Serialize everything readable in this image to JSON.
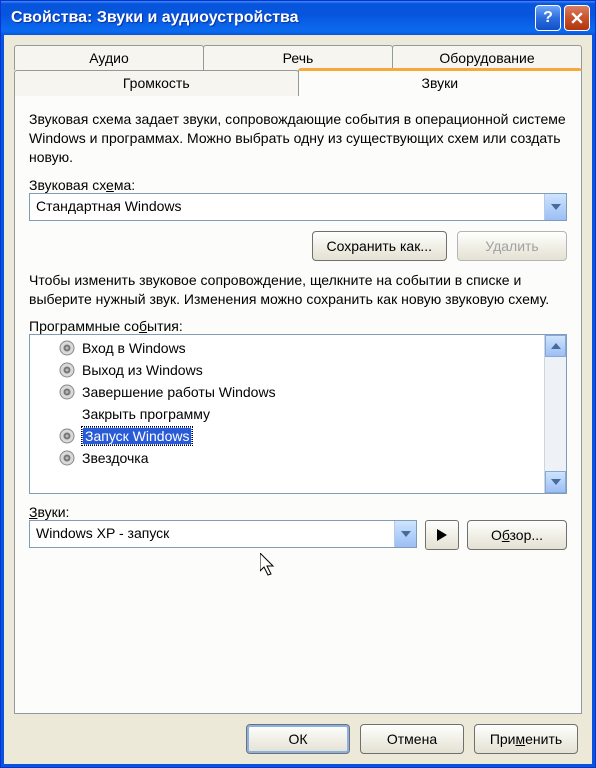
{
  "title": "Свойства: Звуки и аудиоустройства",
  "tabs_row1": [
    {
      "label": "Аудио"
    },
    {
      "label": "Речь"
    },
    {
      "label": "Оборудование"
    }
  ],
  "tabs_row2": [
    {
      "label": "Громкость"
    },
    {
      "label": "Звуки",
      "active": true
    }
  ],
  "scheme_desc": "Звуковая схема задает звуки, сопровождающие события в операционной системе Windows и программах. Можно выбрать одну из существующих схем или создать новую.",
  "scheme_label_pre": "Звуковая сх",
  "scheme_label_ul": "е",
  "scheme_label_post": "ма:",
  "scheme_value": "Стандартная Windows",
  "save_as_label": "Сохранить как...",
  "delete_label": "Удалить",
  "events_desc": "Чтобы изменить звуковое сопровождение, щелкните на событии в списке и выберите нужный звук. Изменения можно сохранить как новую звуковую схему.",
  "events_label_pre": "Программные со",
  "events_label_ul": "б",
  "events_label_post": "ытия:",
  "events": [
    {
      "label": "Вход в Windows",
      "hasSound": true
    },
    {
      "label": "Выход из Windows",
      "hasSound": true
    },
    {
      "label": "Завершение работы Windows",
      "hasSound": true
    },
    {
      "label": "Закрыть программу",
      "hasSound": false
    },
    {
      "label": "Запуск Windows",
      "hasSound": true,
      "selected": true
    },
    {
      "label": "Звездочка",
      "hasSound": true
    }
  ],
  "sounds_label_ul": "З",
  "sounds_label_post": "вуки:",
  "sounds_value": "Windows XP - запуск",
  "browse_label_pre": "О",
  "browse_label_ul": "б",
  "browse_label_post": "зор...",
  "ok_label": "ОК",
  "cancel_label": "Отмена",
  "apply_label_pre": "При",
  "apply_label_ul": "м",
  "apply_label_post": "енить"
}
